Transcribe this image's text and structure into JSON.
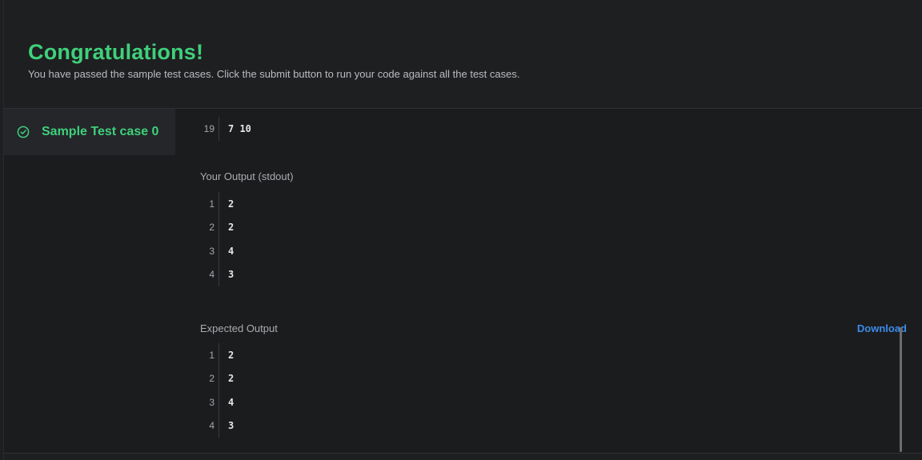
{
  "header": {
    "title": "Congratulations!",
    "subtitle": "You have passed the sample test cases. Click the submit button to run your code against all the test cases."
  },
  "testcase": {
    "label": "Sample Test case 0",
    "status": "passed"
  },
  "input_tail": [
    {
      "line": "19",
      "value": "7 10"
    }
  ],
  "your_output": {
    "label": "Your Output (stdout)",
    "lines": [
      {
        "line": "1",
        "value": "2"
      },
      {
        "line": "2",
        "value": "2"
      },
      {
        "line": "3",
        "value": "4"
      },
      {
        "line": "4",
        "value": "3"
      }
    ]
  },
  "expected_output": {
    "label": "Expected Output",
    "download_label": "Download",
    "lines": [
      {
        "line": "1",
        "value": "2"
      },
      {
        "line": "2",
        "value": "2"
      },
      {
        "line": "3",
        "value": "4"
      },
      {
        "line": "4",
        "value": "3"
      }
    ]
  },
  "colors": {
    "success": "#3fd07a",
    "link": "#3c8bea",
    "background": "#1e1f21"
  },
  "icons": {
    "testcase_status": "check-circle-icon"
  }
}
